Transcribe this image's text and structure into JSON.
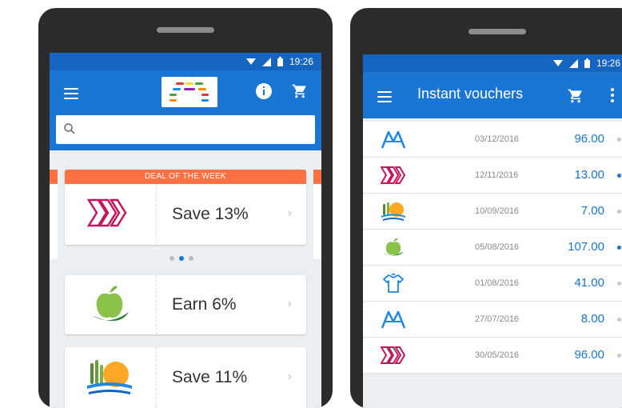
{
  "phone1": {
    "status_time": "19:26",
    "search": {
      "placeholder": ""
    },
    "deal_banner": "DEAL OF THE WEEK",
    "cards": [
      {
        "text": "Save 13%",
        "logo": "chevron-brand-logo"
      },
      {
        "text": "Earn 6%",
        "logo": "apple-brand-logo"
      },
      {
        "text": "Save 11%",
        "logo": "sunset-brand-logo"
      }
    ],
    "chevron": "›",
    "carousel": {
      "count": 3,
      "active": 1
    }
  },
  "phone2": {
    "status_time": "19:26",
    "title": "Instant vouchers",
    "vouchers": [
      {
        "logo": "mountain-brand-logo",
        "date": "03/12/2016",
        "amount": "96.00",
        "active": false
      },
      {
        "logo": "chevron-brand-logo",
        "date": "12/11/2016",
        "amount": "13.00",
        "active": true
      },
      {
        "logo": "sunset-brand-logo",
        "date": "10/09/2016",
        "amount": "7.00",
        "active": false
      },
      {
        "logo": "apple-brand-logo",
        "date": "05/08/2016",
        "amount": "107.00",
        "active": true
      },
      {
        "logo": "shirt-brand-logo",
        "date": "01/08/2016",
        "amount": "41.00",
        "active": false
      },
      {
        "logo": "mountain-brand-logo",
        "date": "27/07/2016",
        "amount": "8.00",
        "active": false
      },
      {
        "logo": "chevron-brand-logo",
        "date": "30/05/2016",
        "amount": "96.00",
        "active": false
      }
    ]
  },
  "colors": {
    "status_bar": "#1565c0",
    "app_bar": "#1976d2",
    "accent": "#1976d2",
    "deal_banner": "#ff7043",
    "brand_chevron": "#c2185b",
    "brand_apple": "#7cb342",
    "brand_sunset": "#ffa726"
  }
}
